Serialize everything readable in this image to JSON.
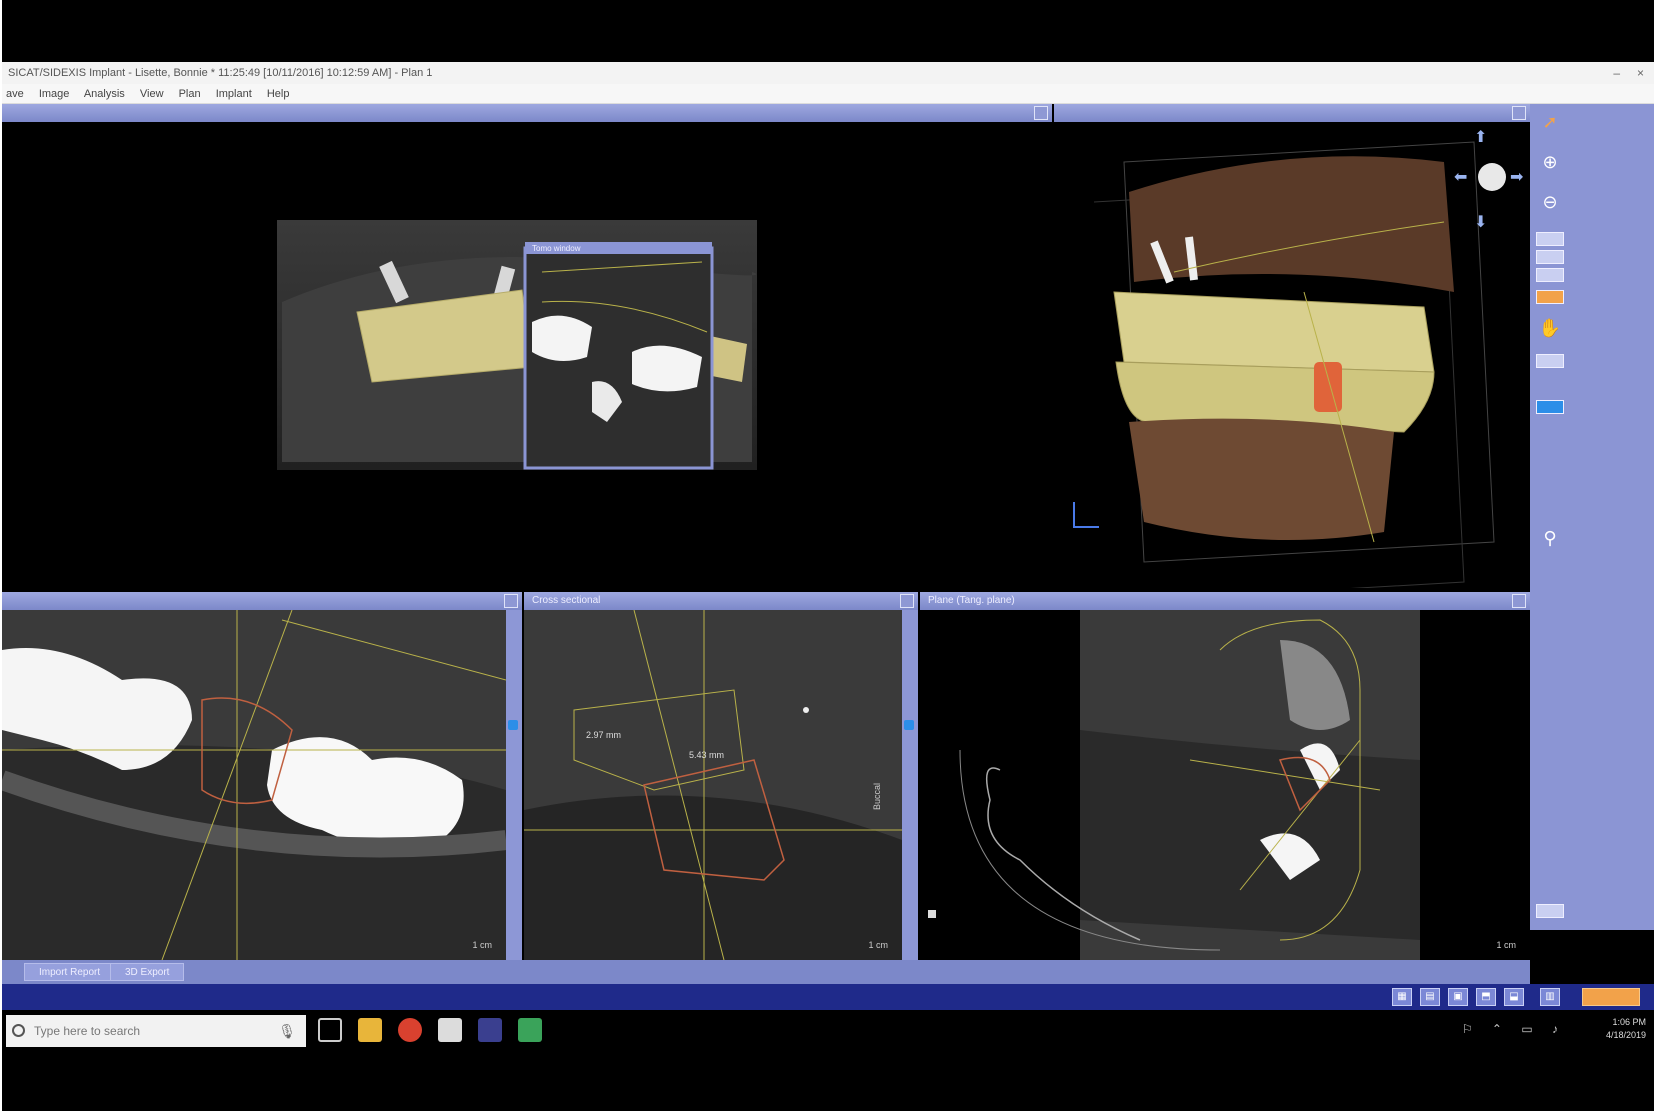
{
  "window": {
    "title": "SICAT/SIDEXIS Implant - Lisette, Bonnie * 11:25:49 [10/11/2016] 10:12:59 AM] - Plan 1",
    "controls": [
      "–",
      "×"
    ]
  },
  "menu": [
    "ave",
    "Image",
    "Analysis",
    "View",
    "Plan",
    "Implant",
    "Help"
  ],
  "panels": {
    "panoramic": {
      "title": "",
      "inset_title": "Tomo window"
    },
    "volume3d": {
      "title": ""
    },
    "axial": {
      "title": "",
      "scale": "1 cm"
    },
    "cross": {
      "title": "Cross sectional",
      "scale": "1 cm",
      "measure1": "2.97 mm",
      "measure2": "5.43 mm",
      "side_label": "Buccal"
    },
    "tangential": {
      "title": "Plane (Tang. plane)",
      "scale": "1 cm"
    }
  },
  "bottom_tabs": [
    "Import Report",
    "3D Export"
  ],
  "taskbar": {
    "search_placeholder": "Type here to search",
    "time": "1:06 PM",
    "date": "4/18/2019"
  },
  "colors": {
    "panel_header": "#7c88c9",
    "toolbar": "#8b95d4",
    "appbar": "#1f2a8a",
    "guide_line": "#b9b24a",
    "implant_outline": "#c06040",
    "crown": "#d9d08f",
    "highlight_tooth": "#e0643a"
  }
}
